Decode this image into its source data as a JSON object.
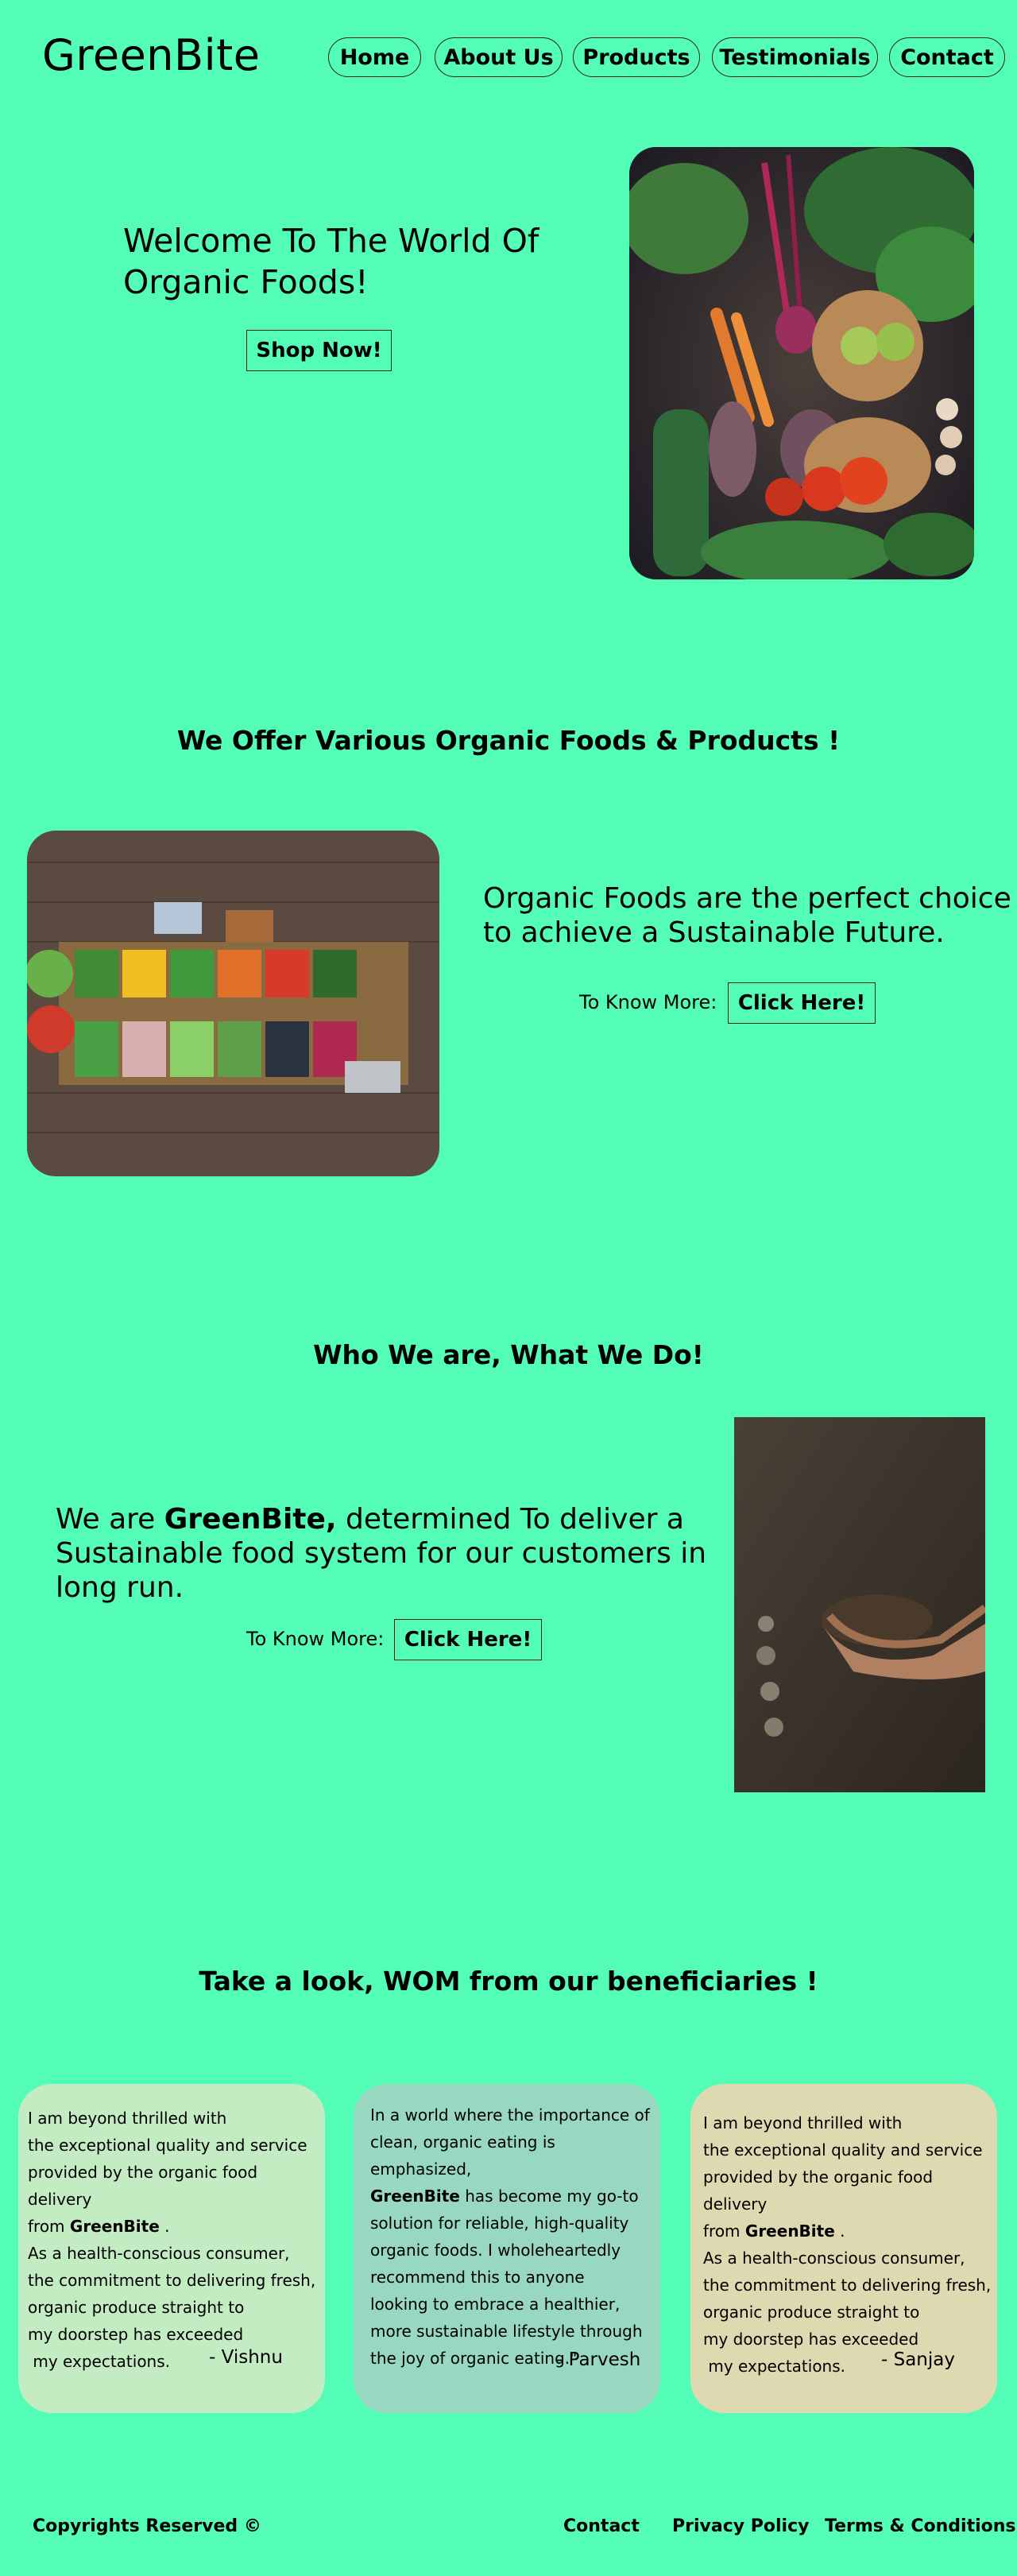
{
  "header": {
    "brand": "GreenBite",
    "nav": [
      {
        "label": "Home"
      },
      {
        "label": "About Us"
      },
      {
        "label": "Products"
      },
      {
        "label": "Testimonials"
      },
      {
        "label": "Contact"
      }
    ]
  },
  "hero": {
    "title": "Welcome To The World Of Organic Foods!",
    "cta": "Shop Now!",
    "image_alt": "vegetables-photo"
  },
  "products": {
    "title": "We Offer Various Organic Foods & Products !",
    "text": "Organic Foods are the perfect choice to achieve a Sustainable Future.",
    "know_more": "To Know More:",
    "cta": "Click Here!"
  },
  "about": {
    "title": "Who We are, What We Do!",
    "text_pre": "We are ",
    "text_brand": "GreenBite,",
    "text_post": " determined To deliver a Sustainable food system for our customers in long run.",
    "know_more": "To Know More:",
    "cta": "Click Here!"
  },
  "testimonials": {
    "title": "Take a look, WOM from our beneficiaries !",
    "cards": [
      {
        "color": "#c3ecc3",
        "lines_a": [
          "I am beyond thrilled with",
          "the exceptional quality and service",
          "provided by the organic food delivery"
        ],
        "from_pre": "from ",
        "brand": "GreenBite",
        "from_post": " .",
        "lines_b": [
          "As a health-conscious consumer,",
          "the commitment to delivering fresh,",
          "organic produce straight to",
          "my doorstep has exceeded",
          " my expectations."
        ],
        "author": "- Vishnu"
      },
      {
        "color": "#98d8c1",
        "intro": [
          "In a world where the importance of",
          "clean, organic eating is emphasized,"
        ],
        "brand": "GreenBite",
        "after_brand": " has become my go-to",
        "lines_b": [
          "solution for reliable, high-quality",
          "organic foods. I wholeheartedly",
          "recommend this to anyone",
          "looking to embrace a healthier,",
          "more sustainable lifestyle through",
          "the joy of organic eating.\""
        ],
        "author": "- Parvesh"
      },
      {
        "color": "#dfd9b1",
        "lines_a": [
          "I am beyond thrilled with",
          "the exceptional quality and service",
          "provided by the organic food delivery"
        ],
        "from_pre": "from ",
        "brand": "GreenBite",
        "from_post": " .",
        "lines_b": [
          "As a health-conscious consumer,",
          "the commitment to delivering fresh,",
          "organic produce straight to",
          "my doorstep has exceeded",
          " my expectations."
        ],
        "author": "- Sanjay"
      }
    ]
  },
  "footer": {
    "copyright": "Copyrights Reserved ©",
    "links": [
      "Contact",
      "Privacy Policy",
      "Terms & Conditions"
    ]
  }
}
